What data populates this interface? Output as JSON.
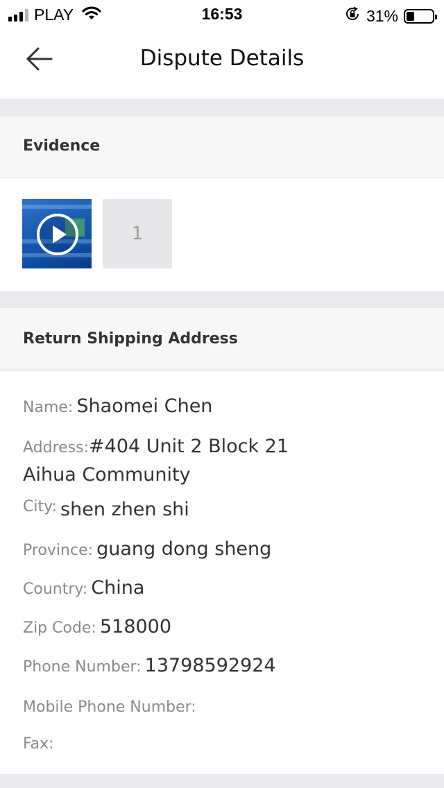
{
  "status_bar": {
    "carrier": "PLAY",
    "time": "16:53",
    "battery_text": "31%",
    "battery_level": 0.31
  },
  "nav": {
    "title": "Dispute Details",
    "back_icon": "back-arrow-icon"
  },
  "evidence": {
    "header": "Evidence",
    "video_icon": "play-icon",
    "count_label": "1"
  },
  "return_address": {
    "header": "Return Shipping Address",
    "name_label": "Name:",
    "name_value": "Shaomei Chen",
    "address_label": "Address:",
    "address_value_line1": "#404 Unit 2 Block 21",
    "address_value_line2": "Aihua Community",
    "city_label": "City:",
    "city_value": "shen zhen shi",
    "province_label": "Province:",
    "province_value": "guang dong sheng",
    "country_label": "Country:",
    "country_value": "China",
    "zip_label": "Zip Code:",
    "zip_value": "518000",
    "phone_label": "Phone Number:",
    "phone_value": "13798592924",
    "mobile_label": "Mobile Phone Number:",
    "mobile_value": "",
    "fax_label": "Fax:",
    "fax_value": ""
  }
}
